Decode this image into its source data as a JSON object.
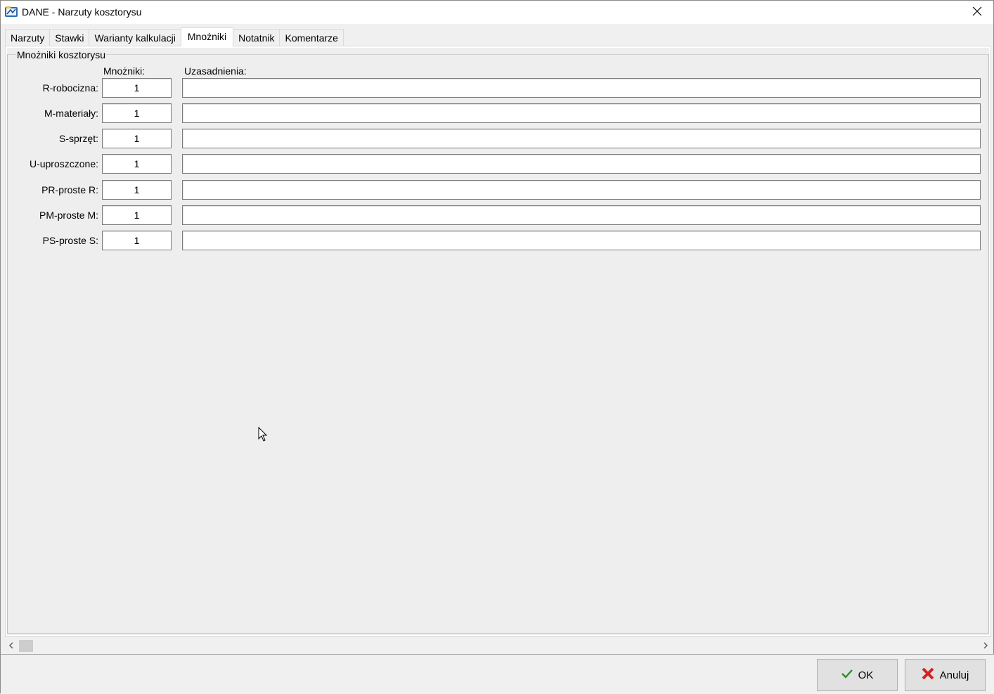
{
  "window": {
    "title": "DANE - Narzuty kosztorysu",
    "icon": "app-icon",
    "close_icon": "close-icon"
  },
  "tabs": [
    {
      "label": "Narzuty",
      "active": false
    },
    {
      "label": "Stawki",
      "active": false
    },
    {
      "label": "Warianty kalkulacji",
      "active": false
    },
    {
      "label": "Mnożniki",
      "active": true
    },
    {
      "label": "Notatnik",
      "active": false
    },
    {
      "label": "Komentarze",
      "active": false
    }
  ],
  "group": {
    "title": "Mnożniki kosztorysu",
    "col_multipliers": "Mnożniki:",
    "col_justifications": "Uzasadnienia:"
  },
  "rows": [
    {
      "label": "R-robocizna:",
      "value": "1",
      "justification": ""
    },
    {
      "label": "M-materiały:",
      "value": "1",
      "justification": ""
    },
    {
      "label": "S-sprzęt:",
      "value": "1",
      "justification": ""
    },
    {
      "label": "U-uproszczone:",
      "value": "1",
      "justification": ""
    },
    {
      "label": "PR-proste R:",
      "value": "1",
      "justification": ""
    },
    {
      "label": "PM-proste M:",
      "value": "1",
      "justification": ""
    },
    {
      "label": "PS-proste S:",
      "value": "1",
      "justification": ""
    }
  ],
  "buttons": {
    "ok_label": "OK",
    "cancel_label": "Anuluj"
  },
  "colors": {
    "ok_check": "#2e8b2e",
    "cancel_x": "#d32020",
    "panel_bg": "#eeeeee"
  }
}
